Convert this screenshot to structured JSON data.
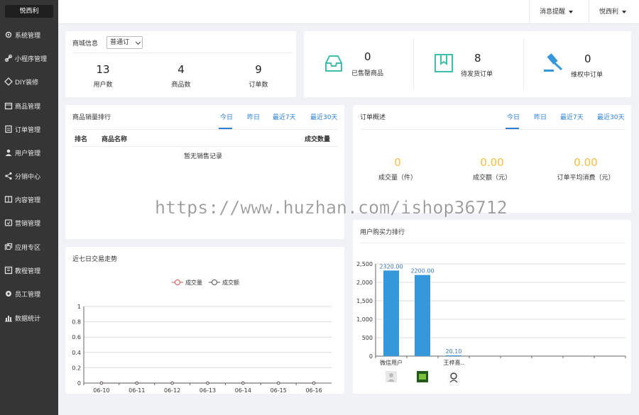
{
  "brand": "悦西利",
  "sidebar": {
    "items": [
      {
        "label": "系统管理",
        "icon": "gear-icon"
      },
      {
        "label": "小程序管理",
        "icon": "link-icon"
      },
      {
        "label": "DIY装修",
        "icon": "diamond-icon"
      },
      {
        "label": "商品管理",
        "icon": "box-icon"
      },
      {
        "label": "订单管理",
        "icon": "order-icon"
      },
      {
        "label": "用户管理",
        "icon": "user-icon"
      },
      {
        "label": "分销中心",
        "icon": "share-icon"
      },
      {
        "label": "内容管理",
        "icon": "content-icon"
      },
      {
        "label": "营销管理",
        "icon": "marketing-icon"
      },
      {
        "label": "应用专区",
        "icon": "apps-icon"
      },
      {
        "label": "教程管理",
        "icon": "book-icon"
      },
      {
        "label": "员工管理",
        "icon": "staff-icon"
      },
      {
        "label": "数据统计",
        "icon": "chart-icon"
      }
    ]
  },
  "topbar": {
    "notifications_label": "消息提醒",
    "user_label": "悦西利"
  },
  "shop_info": {
    "title": "商城信息",
    "select_value": "普通订",
    "stats": [
      {
        "value": "13",
        "label": "用户数"
      },
      {
        "value": "4",
        "label": "商品数"
      },
      {
        "value": "9",
        "label": "订单数"
      }
    ]
  },
  "order_status": {
    "items": [
      {
        "value": "0",
        "label": "已售罄商品",
        "icon": "inbox-icon"
      },
      {
        "value": "8",
        "label": "待发货订单",
        "icon": "package-icon"
      },
      {
        "value": "0",
        "label": "维权中订单",
        "icon": "gavel-icon"
      }
    ],
    "accent": "#3fbfa9"
  },
  "sales_rank": {
    "title": "商品销量排行",
    "tabs": [
      "今日",
      "昨日",
      "最近7天",
      "最近30天"
    ],
    "columns": [
      "排名",
      "商品名称",
      "成交数量"
    ],
    "empty_text": "暂无销售记录"
  },
  "order_overview": {
    "title": "订单概述",
    "tabs": [
      "今日",
      "昨日",
      "最近7天",
      "最近30天"
    ],
    "stats": [
      {
        "value": "0",
        "label": "成交量（件）"
      },
      {
        "value": "0.00",
        "label": "成交额（元）"
      },
      {
        "value": "0.00",
        "label": "订单平均消费（元）"
      }
    ],
    "value_color": "#f5bd3e"
  },
  "trend": {
    "title": "近七日交易走势",
    "chart_data": {
      "type": "line",
      "x": [
        "06-10",
        "06-11",
        "06-12",
        "06-13",
        "06-14",
        "06-15",
        "06-16"
      ],
      "series": [
        {
          "name": "成交量",
          "values": [
            0,
            0,
            0,
            0,
            0,
            0,
            0
          ],
          "color": "#d9534f"
        },
        {
          "name": "成交额",
          "values": [
            0,
            0,
            0,
            0,
            0,
            0,
            0
          ],
          "color": "#555555"
        }
      ],
      "ylim": [
        0,
        1
      ],
      "yticks": [
        "0",
        "0.2",
        "0.4",
        "0.6",
        "0.8",
        "1"
      ],
      "grid": true,
      "legend": "top-center"
    }
  },
  "buying_power": {
    "title": "用户购买力排行",
    "chart_data": {
      "type": "bar",
      "categories": [
        "微信用户",
        "",
        "王梓熹.."
      ],
      "values": [
        2320,
        2200,
        20.1
      ],
      "value_labels": [
        "2320.00",
        "2200.00",
        "20.10"
      ],
      "ylim": [
        0,
        2500
      ],
      "yticks": [
        "0",
        "500",
        "1,000",
        "1,500",
        "2,000",
        "2,500"
      ],
      "grid": true,
      "bar_color": "#3498db",
      "empty_slots": 5
    },
    "avatars": [
      "avatar-default",
      "avatar-green",
      "avatar-sketch"
    ]
  },
  "watermark": "https://www.huzhan.com/ishop36712"
}
